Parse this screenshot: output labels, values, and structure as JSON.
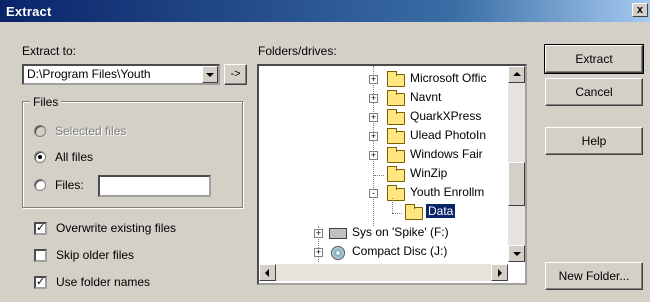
{
  "window": {
    "title": "Extract",
    "close_label": "x"
  },
  "extract_to": {
    "label": "Extract to:",
    "path": "D:\\Program Files\\Youth",
    "browse_label": "->"
  },
  "files_group": {
    "legend": "Files",
    "options": [
      {
        "label": "Selected files",
        "state": "disabled"
      },
      {
        "label": "All files",
        "state": "checked"
      },
      {
        "label": "Files:",
        "state": "unchecked"
      }
    ],
    "files_value": ""
  },
  "checkboxes": [
    {
      "label": "Overwrite existing files",
      "checked": true
    },
    {
      "label": "Skip older files",
      "checked": false
    },
    {
      "label": "Use folder names",
      "checked": true
    }
  ],
  "folders": {
    "label": "Folders/drives:",
    "items": [
      {
        "label": "Microsoft Offic",
        "expander": "+",
        "icon": "folder-icon"
      },
      {
        "label": "Navnt",
        "expander": "+",
        "icon": "folder-icon"
      },
      {
        "label": "QuarkXPress",
        "expander": "+",
        "icon": "folder-icon"
      },
      {
        "label": "Ulead PhotoIn",
        "expander": "+",
        "icon": "folder-icon"
      },
      {
        "label": "Windows Fair",
        "expander": "+",
        "icon": "folder-icon"
      },
      {
        "label": "WinZip",
        "expander": "",
        "icon": "folder-icon"
      },
      {
        "label": "Youth Enrollm",
        "expander": "-",
        "icon": "folder-open-icon"
      },
      {
        "label": "Data",
        "expander": "",
        "icon": "folder-open-icon",
        "selected": true
      },
      {
        "label": "Sys on 'Spike' (F:)",
        "expander": "+",
        "icon": "network-drive-icon"
      },
      {
        "label": "Compact Disc (J:)",
        "expander": "+",
        "icon": "cd-drive-icon"
      }
    ]
  },
  "buttons": {
    "extract": "Extract",
    "cancel": "Cancel",
    "help": "Help",
    "new_folder": "New Folder..."
  },
  "colors": {
    "titlebar": "#0a246a",
    "face": "#d4d0c8",
    "selection": "#0a246a"
  }
}
